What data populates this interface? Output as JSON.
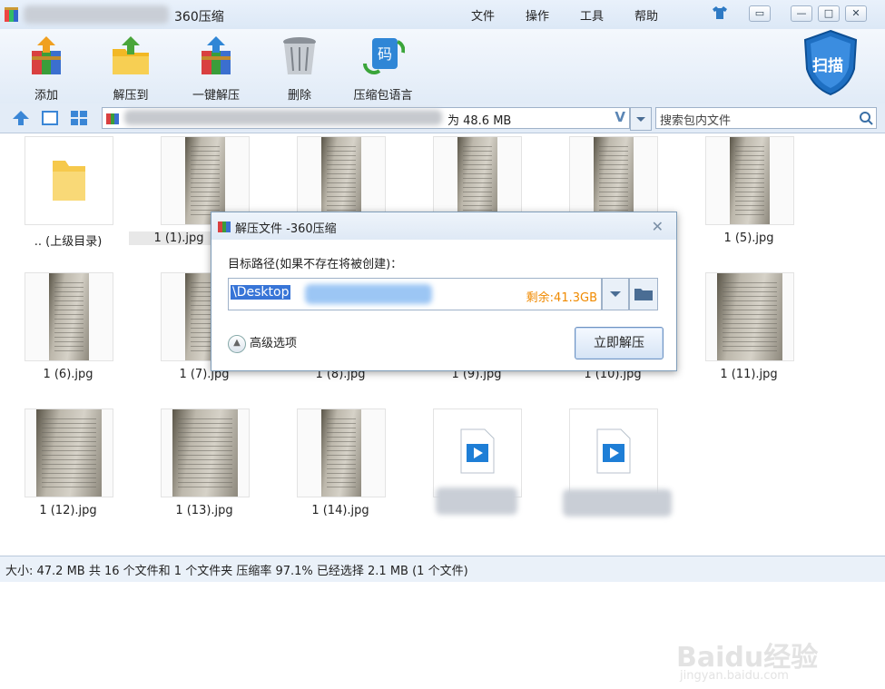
{
  "app": {
    "title": "360压缩"
  },
  "menu": [
    "文件",
    "操作",
    "工具",
    "帮助"
  ],
  "window_buttons": [
    "shirt-icon",
    "feedback-icon",
    "minimize",
    "maximize",
    "close"
  ],
  "toolbar": [
    {
      "label": "添加",
      "icon": "add-archive-icon"
    },
    {
      "label": "解压到",
      "icon": "extract-to-icon"
    },
    {
      "label": "一键解压",
      "icon": "one-click-extract-icon"
    },
    {
      "label": "删除",
      "icon": "trash-icon"
    },
    {
      "label": "压缩包语言",
      "icon": "archive-language-icon"
    }
  ],
  "scan": {
    "label": "扫描"
  },
  "path": {
    "text": "为 48.6 MB"
  },
  "search": {
    "placeholder": "搜索包内文件"
  },
  "files": [
    {
      "name": ".. (上级目录)",
      "kind": "folder"
    },
    {
      "name": "1 (1).jpg",
      "kind": "photo"
    },
    {
      "name": "",
      "kind": "photo"
    },
    {
      "name": "",
      "kind": "photo"
    },
    {
      "name": "",
      "kind": "photo"
    },
    {
      "name": "1 (5).jpg",
      "kind": "photo"
    },
    {
      "name": "1 (6).jpg",
      "kind": "photo"
    },
    {
      "name": "1 (7).jpg",
      "kind": "photo"
    },
    {
      "name": "1 (8).jpg",
      "kind": "photo"
    },
    {
      "name": "1 (9).jpg",
      "kind": "photo"
    },
    {
      "name": "1 (10).jpg",
      "kind": "photo"
    },
    {
      "name": "1 (11).jpg",
      "kind": "photo"
    },
    {
      "name": "1 (12).jpg",
      "kind": "photo"
    },
    {
      "name": "1 (13).jpg",
      "kind": "photo"
    },
    {
      "name": "1 (14).jpg",
      "kind": "photo"
    },
    {
      "name": "",
      "kind": "video"
    },
    {
      "name": "",
      "kind": "video"
    }
  ],
  "status": {
    "text": "大小: 47.2 MB 共 16 个文件和 1 个文件夹 压缩率 97.1% 已经选择 2.1 MB (1 个文件)"
  },
  "dialog": {
    "title": "解压文件 -360压缩",
    "label": "目标路径(如果不存在将被创建)：",
    "path_value": "\\Desktop",
    "free_space": "剩余:41.3GB",
    "advanced": "高级选项",
    "extract_button": "立即解压"
  },
  "watermark": {
    "text": "Baidu经验",
    "sub": "jingyan.baidu.com"
  }
}
